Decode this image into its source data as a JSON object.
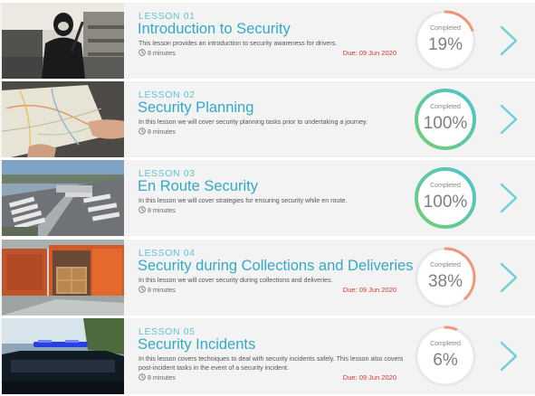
{
  "colors": {
    "accent": "#33a9c8",
    "due_text": "#d9352c",
    "arc_complete_start": "#6fcf6f",
    "arc_complete_end": "#4fc3d1",
    "arc_partial": "#ef9578",
    "chevron": "#6fcfd6"
  },
  "lessons": [
    {
      "number": "LESSON 01",
      "title": "Introduction to Security",
      "description": "This lesson provides an introduction to security awareness for drivers.",
      "duration": "8 minutes",
      "due": "Due: 09 Jun 2020",
      "progress_label": "Completed",
      "progress_text": "19%",
      "progress": 19,
      "thumbnail_icon": "masked-intruder-image"
    },
    {
      "number": "LESSON 02",
      "title": "Security Planning",
      "description": "In this lesson we will cover security planning tasks prior to undertaking a journey.",
      "duration": "8 minutes",
      "due": "",
      "progress_label": "Completed",
      "progress_text": "100%",
      "progress": 100,
      "thumbnail_icon": "road-map-image"
    },
    {
      "number": "LESSON 03",
      "title": "En Route Security",
      "description": "In this lesson we will cover strategies for ensuring security while en route.",
      "duration": "8 minutes",
      "due": "",
      "progress_label": "Completed",
      "progress_text": "100%",
      "progress": 100,
      "thumbnail_icon": "truck-stop-image"
    },
    {
      "number": "LESSON 04",
      "title": "Security during Collections and Deliveries",
      "description": "In this lesson we will cover security during collections and deliveries.",
      "duration": "8 minutes",
      "due": "Due: 09 Jun 2020",
      "progress_label": "Completed",
      "progress_text": "38%",
      "progress": 38,
      "thumbnail_icon": "loading-truck-image"
    },
    {
      "number": "LESSON 05",
      "title": "Security Incidents",
      "description": "In this lesson covers techniques to deal with security incidents safely. This lesson also covers post-incident tasks in the event of a security incident.",
      "duration": "8 minutes",
      "due": "Due: 09 Jun 2020",
      "progress_label": "Completed",
      "progress_text": "6%",
      "progress": 6,
      "thumbnail_icon": "police-car-image"
    }
  ]
}
